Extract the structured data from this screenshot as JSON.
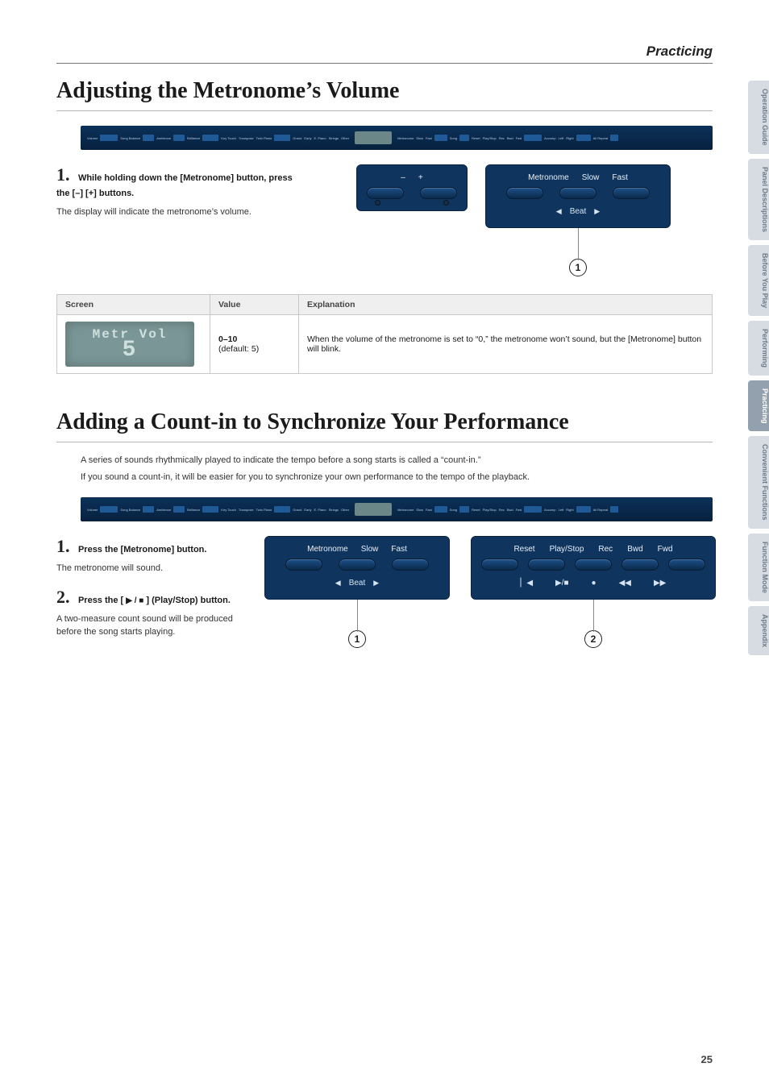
{
  "header": {
    "section": "Practicing"
  },
  "sidebar": {
    "tabs": [
      {
        "label": "Operation Guide"
      },
      {
        "label": "Panel Descriptions"
      },
      {
        "label": "Before You Play"
      },
      {
        "label": "Performing"
      },
      {
        "label": "Practicing",
        "active": true
      },
      {
        "label": "Convenient Functions"
      },
      {
        "label": "Function Mode"
      },
      {
        "label": "Appendix"
      }
    ]
  },
  "panel_strip": {
    "labels": [
      "Volume",
      "Song Balance",
      "Ambience",
      "Brilliance",
      "Key Touch",
      "Transpose",
      "Twin Piano",
      "Grand",
      "Early",
      "E. Piano",
      "Strings",
      "Other",
      "Metronome",
      "Slow",
      "Fast",
      "Song",
      "Reset",
      "Play/Stop",
      "Rec",
      "Bwd",
      "Fwd",
      "Accomp",
      "Left",
      "Right",
      "All Repeat"
    ]
  },
  "sectionA": {
    "title": "Adjusting the Metronome’s Volume",
    "step1_num": "1.",
    "step1_title": "While holding down the [Metronome] button, press the [–] [+] buttons.",
    "step1_body": "The display will indicate the metronome’s volume.",
    "clusterL": {
      "minus": "–",
      "plus": "+"
    },
    "clusterR": {
      "metronome": "Metronome",
      "slow": "Slow",
      "fast": "Fast",
      "beat": "Beat",
      "l": "◀",
      "r": "▶"
    },
    "callout1": "1",
    "table": {
      "col1": "Screen",
      "col2": "Value",
      "col3": "Explanation",
      "screen_l1": "Metr Vol",
      "screen_l2": "5",
      "value": "0–10",
      "value_default": "(default: 5)",
      "explanation": "When the volume of the metronome is set to “0,” the metronome won’t sound, but the [Metronome] button will blink."
    }
  },
  "sectionB": {
    "title": "Adding a Count-in to Synchronize Your Performance",
    "intro1": "A series of sounds rhythmically played to indicate the tempo before a song starts is called a “count-in.”",
    "intro2": "If you sound a count-in, it will be easier for you to synchronize your own performance to the tempo of the playback.",
    "step1_num": "1.",
    "step1_title": "Press the [Metronome] button.",
    "step1_body": "The metronome will sound.",
    "step2_num": "2.",
    "step2_title_a": "Press the [",
    "step2_title_b": " ] (Play/Stop) button.",
    "play_glyphs": "▶ / ■",
    "step2_body": "A two-measure count sound will be produced before the song starts playing.",
    "clusterL": {
      "metronome": "Metronome",
      "slow": "Slow",
      "fast": "Fast",
      "beat": "Beat",
      "l": "◀",
      "r": "▶"
    },
    "clusterR": {
      "reset": "Reset",
      "play": "Play/Stop",
      "rec": "Rec",
      "bwd": "Bwd",
      "fwd": "Fwd",
      "g_reset": "▏◀",
      "g_play": "▶/■",
      "g_rec": "●",
      "g_bwd": "◀◀",
      "g_fwd": "▶▶"
    },
    "callout1": "1",
    "callout2": "2"
  },
  "page_number": "25"
}
